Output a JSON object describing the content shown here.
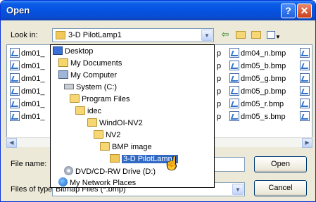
{
  "window": {
    "title": "Open",
    "help_icon": "?",
    "close_icon": "✕"
  },
  "look_in": {
    "label": "Look in:",
    "value": "3-D PilotLamp1"
  },
  "toolbar": {
    "back_icon": "⇦",
    "up_icon": "folder-up-icon",
    "new_folder_icon": "new-folder-icon",
    "views_icon": "views-menu-icon"
  },
  "files": {
    "left_column": [
      "dm01_",
      "dm01_",
      "dm01_",
      "dm01_",
      "dm01_",
      "dm01_"
    ],
    "middle_column": [
      "dm04_n.bmp",
      "dm05_b.bmp",
      "dm05_g.bmp",
      "dm05_p.bmp",
      "dm05_r.bmp",
      "dm05_s.bmp"
    ],
    "partial_marks": [
      "p",
      "p",
      "p",
      "p",
      "p",
      "p"
    ]
  },
  "file_name": {
    "label": "File name:",
    "value": ""
  },
  "files_of_type": {
    "label": "Files of type:",
    "value": "Bitmap Files (*.bmp)"
  },
  "buttons": {
    "open": "Open",
    "cancel": "Cancel"
  },
  "dropdown": {
    "items": [
      {
        "label": "Desktop",
        "icon": "desktop-icon",
        "indent": 0
      },
      {
        "label": "My Documents",
        "icon": "my-documents-icon",
        "indent": 1
      },
      {
        "label": "My Computer",
        "icon": "my-computer-icon",
        "indent": 1
      },
      {
        "label": "System (C:)",
        "icon": "hard-drive-icon",
        "indent": 2
      },
      {
        "label": "Program Files",
        "icon": "folder-icon",
        "indent": 3
      },
      {
        "label": "idec",
        "icon": "folder-icon",
        "indent": 4
      },
      {
        "label": "WindOI-NV2",
        "icon": "folder-icon",
        "indent": 5
      },
      {
        "label": "NV2",
        "icon": "folder-icon",
        "indent": 6
      },
      {
        "label": "BMP image",
        "icon": "folder-icon",
        "indent": 7
      },
      {
        "label": "3-D PilotLamp1",
        "icon": "open-folder-icon",
        "indent": 8,
        "selected": true
      },
      {
        "label": "DVD/CD-RW Drive (D:)",
        "icon": "cd-drive-icon",
        "indent": 2
      },
      {
        "label": "My Network Places",
        "icon": "network-places-icon",
        "indent": 1
      }
    ]
  }
}
